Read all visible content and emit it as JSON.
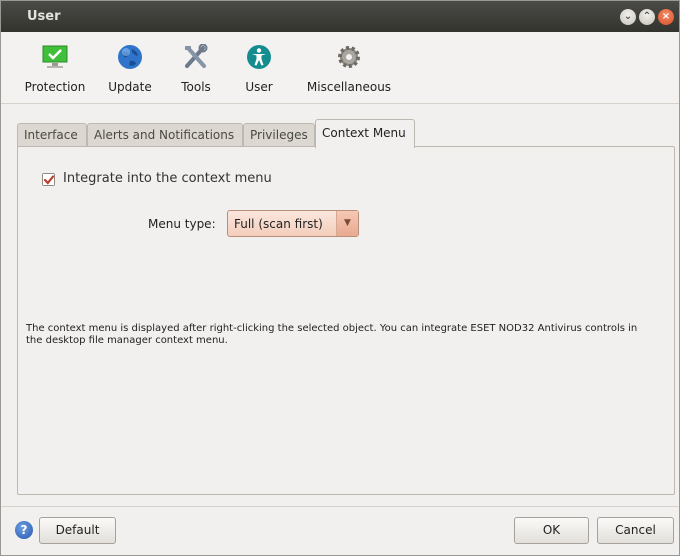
{
  "window": {
    "title": "User"
  },
  "toolbar": {
    "items": [
      {
        "label": "Protection",
        "icon": "monitor-check-icon"
      },
      {
        "label": "Update",
        "icon": "globe-icon"
      },
      {
        "label": "Tools",
        "icon": "tools-icon"
      },
      {
        "label": "User",
        "icon": "user-accessibility-icon"
      },
      {
        "label": "Miscellaneous",
        "icon": "gear-icon"
      }
    ]
  },
  "tabs": [
    {
      "label": "Interface"
    },
    {
      "label": "Alerts and Notifications"
    },
    {
      "label": "Privileges"
    },
    {
      "label": "Context Menu",
      "active": true
    }
  ],
  "context_menu": {
    "integrate_label": "Integrate into the context menu",
    "integrate_checked": true,
    "menu_type_label": "Menu type:",
    "menu_type_value": "Full (scan first)",
    "description": "The context menu is displayed after right-clicking the selected object. You can integrate ESET NOD32 Antivirus controls in the desktop file manager context menu."
  },
  "footer": {
    "default_label": "Default",
    "ok_label": "OK",
    "cancel_label": "Cancel"
  },
  "colors": {
    "titlebar": "#3f3f3b",
    "close_button": "#e0603a",
    "dropdown_accent": "#f3cdbb",
    "check_mark": "#c0392b"
  }
}
